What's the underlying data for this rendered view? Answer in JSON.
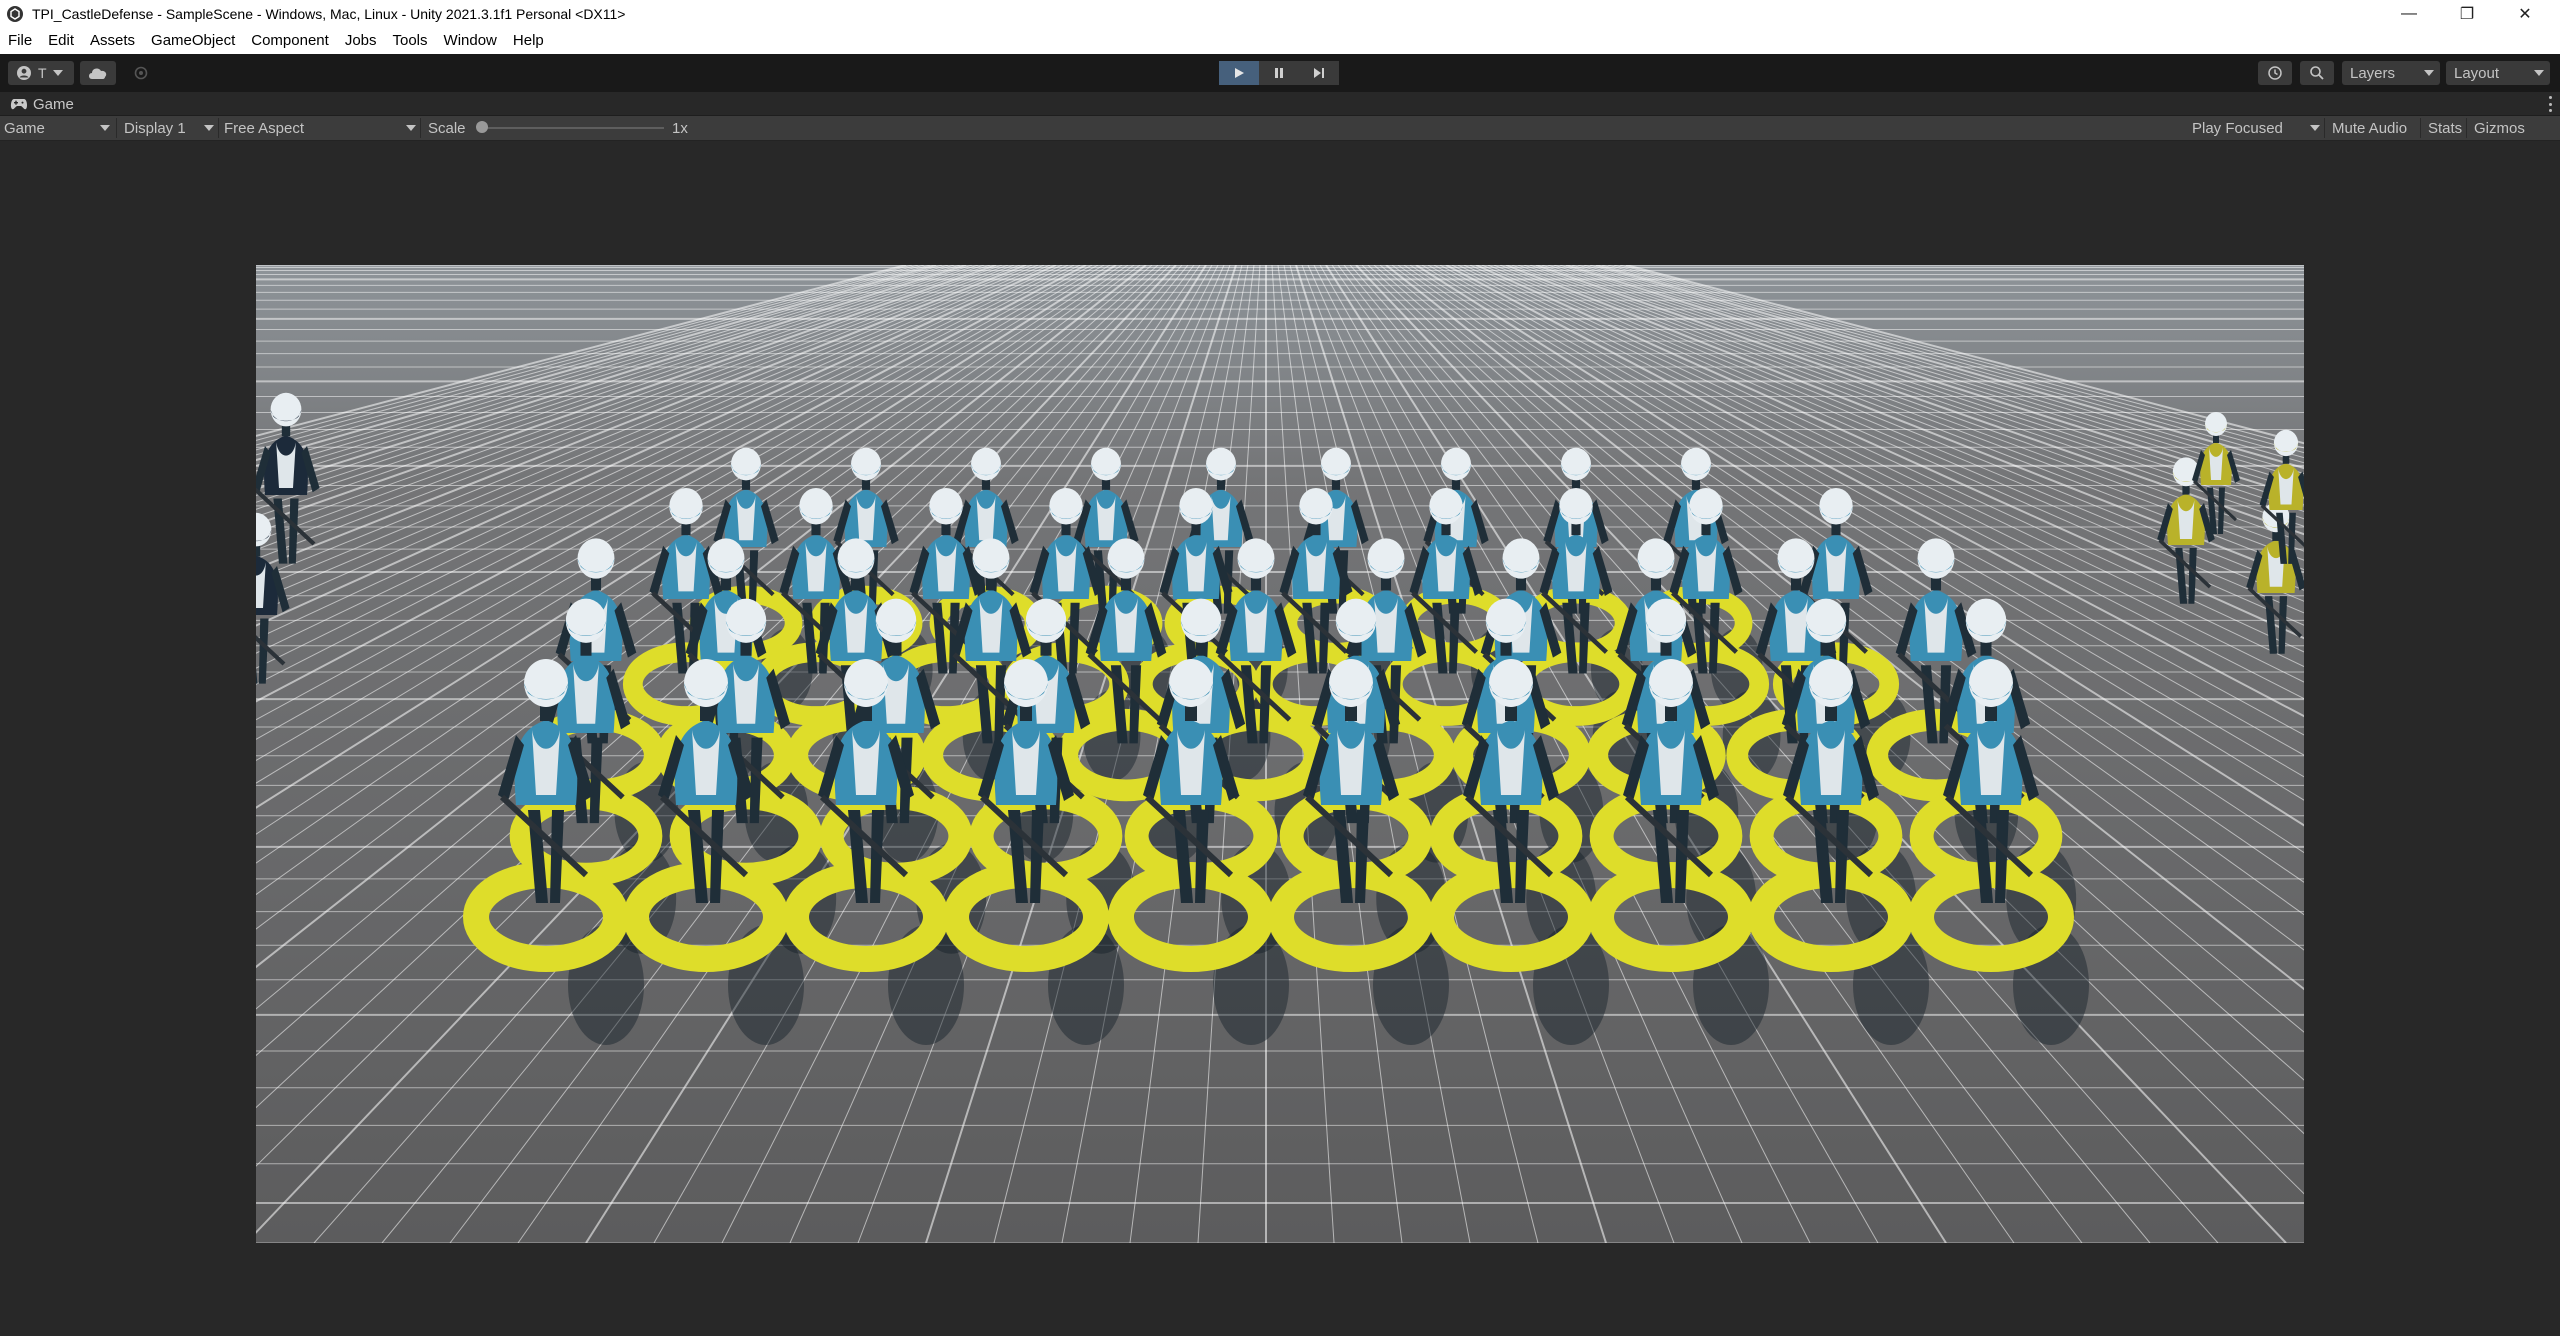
{
  "window": {
    "title": "TPI_CastleDefense - SampleScene - Windows, Mac, Linux - Unity 2021.3.1f1 Personal <DX11>",
    "minimize_glyph": "—",
    "restore_glyph": "❐",
    "close_glyph": "✕"
  },
  "menu": {
    "items": [
      "File",
      "Edit",
      "Assets",
      "GameObject",
      "Component",
      "Jobs",
      "Tools",
      "Window",
      "Help"
    ]
  },
  "toolbar": {
    "account_label": "T",
    "layers_label": "Layers",
    "layout_label": "Layout",
    "play_active": true
  },
  "tab": {
    "label": "Game"
  },
  "game_toolbar": {
    "view_mode": "Game",
    "display": "Display 1",
    "aspect": "Free Aspect",
    "scale_label": "Scale",
    "scale_value": "1x",
    "scale_level": 0,
    "play_mode": "Play Focused",
    "mute_audio": "Mute Audio",
    "stats": "Stats",
    "gizmos": "Gizmos"
  },
  "colors": {
    "accent_play": "#46607c",
    "ring_yellow": "#dedd2a",
    "robot_blue": "#3a8fb4",
    "robot_yellow": "#b9b22a",
    "ground": "#5e5e5e",
    "sky": "#8a9096"
  }
}
